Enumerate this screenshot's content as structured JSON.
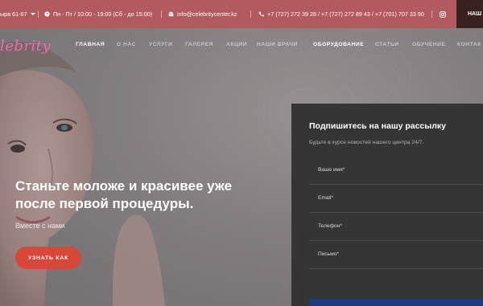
{
  "topbar": {
    "address": "ыра 61-67",
    "hours": "Пн - Пт / 10:00 - 19:00 (Сб - до 15:00)",
    "email": "info@celebritycenter.kz",
    "phones": "+7 (727) 272 39 28 / +7 (727) 272 89 43 / +7 (701) 707 33 90",
    "cta_label": "НАШ"
  },
  "logo": {
    "text": "lebrity"
  },
  "nav": {
    "items": [
      "ГЛАВНАЯ",
      "О НАС",
      "УСЛУГИ",
      "ГАЛЕРЕЯ",
      "АКЦИИ",
      "НАШИ ВРАЧИ",
      "ОБОРУДОВАНИЕ",
      "СТАТЬИ",
      "ОБУЧЕНИЕ",
      "КОНТАК"
    ]
  },
  "hero": {
    "headline_line1": "Станьте моложе и красивее уже",
    "headline_line2": "после первой процедуры.",
    "subtitle": "Вместе с нами",
    "button_label": "УЗНАТЬ КАК"
  },
  "newsletter": {
    "title": "Подпишитесь на нашу рассылку",
    "description": "Будьте в курсе новостей нашего центра 24/7.",
    "name_placeholder": "Ваше имя*",
    "email_placeholder": "Email*",
    "phone_placeholder": "Телефон*",
    "message_placeholder": "Письмо*"
  },
  "colors": {
    "topbar": "#b25a5d",
    "accent_button": "#d8473a",
    "logo": "#f06bb0",
    "panel": "#353535"
  }
}
